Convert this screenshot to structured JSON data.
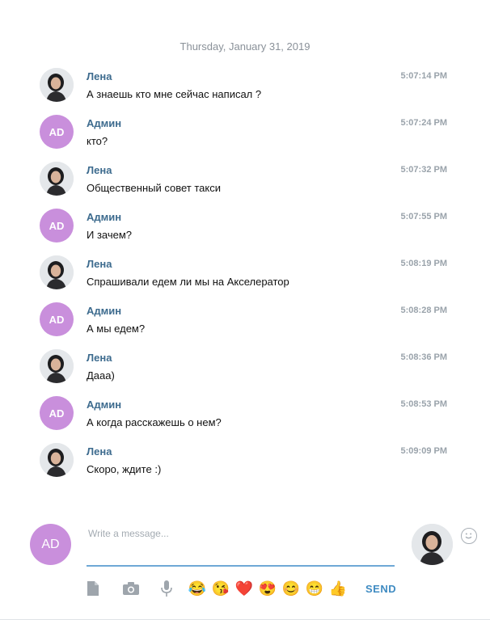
{
  "date_separator": "Thursday, January 31, 2019",
  "messages": [
    {
      "author": "Лена",
      "time": "5:07:14 PM",
      "text": "А знаешь кто мне сейчас написал ?",
      "avatar": "photo"
    },
    {
      "author": "Админ",
      "time": "5:07:24 PM",
      "text": "кто?",
      "avatar": "AD"
    },
    {
      "author": "Лена",
      "time": "5:07:32 PM",
      "text": "Общественный совет такси",
      "avatar": "photo"
    },
    {
      "author": "Админ",
      "time": "5:07:55 PM",
      "text": "И зачем?",
      "avatar": "AD"
    },
    {
      "author": "Лена",
      "time": "5:08:19 PM",
      "text": "Спрашивали едем ли мы на Акселератор",
      "avatar": "photo"
    },
    {
      "author": "Админ",
      "time": "5:08:28 PM",
      "text": "А мы едем?",
      "avatar": "AD"
    },
    {
      "author": "Лена",
      "time": "5:08:36 PM",
      "text": "Дааа)",
      "avatar": "photo"
    },
    {
      "author": "Админ",
      "time": "5:08:53 PM",
      "text": "А когда расскажешь о нем?",
      "avatar": "AD"
    },
    {
      "author": "Лена",
      "time": "5:09:09 PM",
      "text": "Скоро, ждите :)",
      "avatar": "photo"
    }
  ],
  "composer": {
    "my_avatar_initials": "AD",
    "placeholder": "Write a message...",
    "value": "",
    "send_label": "SEND",
    "emojis": [
      "😂",
      "😘",
      "❤️",
      "😍",
      "😊",
      "😁",
      "👍"
    ]
  },
  "colors": {
    "author": "#3d6b8e",
    "admin_avatar": "#c98fdc",
    "send": "#3f8bc2",
    "input_underline": "#6fa8d6"
  },
  "icons": [
    "document-icon",
    "camera-icon",
    "microphone-icon",
    "smile-icon"
  ]
}
